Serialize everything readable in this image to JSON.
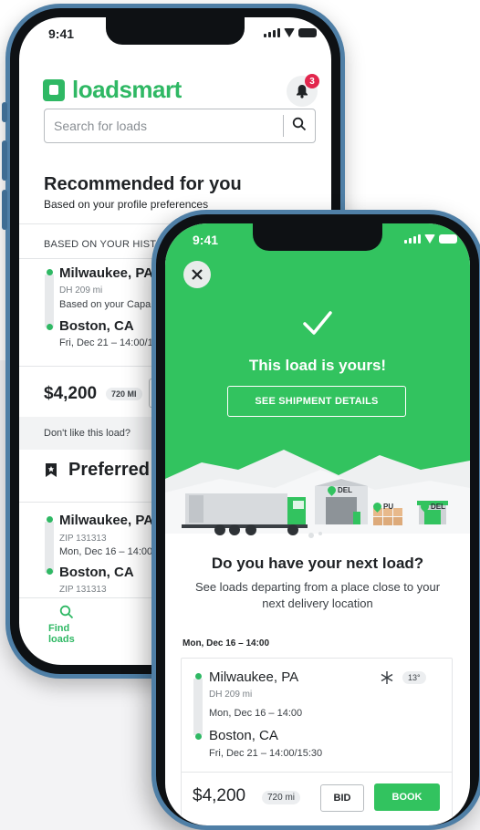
{
  "colors": {
    "brand_green": "#32c35f",
    "badge_red": "#e2264d",
    "frame_blue": "#4f7fa6"
  },
  "phone1": {
    "status_time": "9:41",
    "logo_text": "loadsmart",
    "notifications_count": "3",
    "search_placeholder": "Search for loads",
    "recommended_title": "Recommended for you",
    "recommended_sub": "Based on your profile preferences",
    "history_label": "BASED ON YOUR HISTOR",
    "card": {
      "origin": "Milwaukee, PA",
      "origin_dh": "DH 209 mi",
      "origin_note": "Based on your Capa",
      "destination": "Boston, CA",
      "destination_date": "Fri, Dec 21 – 14:00/15",
      "price": "$4,200",
      "distance": "720 MI",
      "dislike": "Don't like this load?"
    },
    "preferred_title": "Preferred l",
    "preferred_card": {
      "origin": "Milwaukee, PA",
      "origin_zip": "ZIP 131313",
      "origin_date": "Mon, Dec 16 – 14:00",
      "destination": "Boston, CA",
      "destination_zip": "ZIP 131313"
    },
    "nav_find": "Find loads"
  },
  "phone2": {
    "status_time": "9:41",
    "success_title": "This load is yours!",
    "see_details": "SEE SHIPMENT DETAILS",
    "pins": {
      "del1": "DEL",
      "pu": "PU",
      "del2": "DEL"
    },
    "next_title": "Do you have your next load?",
    "next_sub": "See loads departing from a place close to your next delivery location",
    "date_header": "Mon, Dec 16 – 14:00",
    "card": {
      "origin": "Milwaukee, PA",
      "origin_dh": "DH 209 mi",
      "origin_date": "Mon, Dec 16 – 14:00",
      "temp": "13°",
      "destination": "Boston, CA",
      "destination_date": "Fri, Dec 21 – 14:00/15:30",
      "price": "$4,200",
      "distance": "720 mi",
      "bid": "BID",
      "book": "BOOK"
    }
  }
}
